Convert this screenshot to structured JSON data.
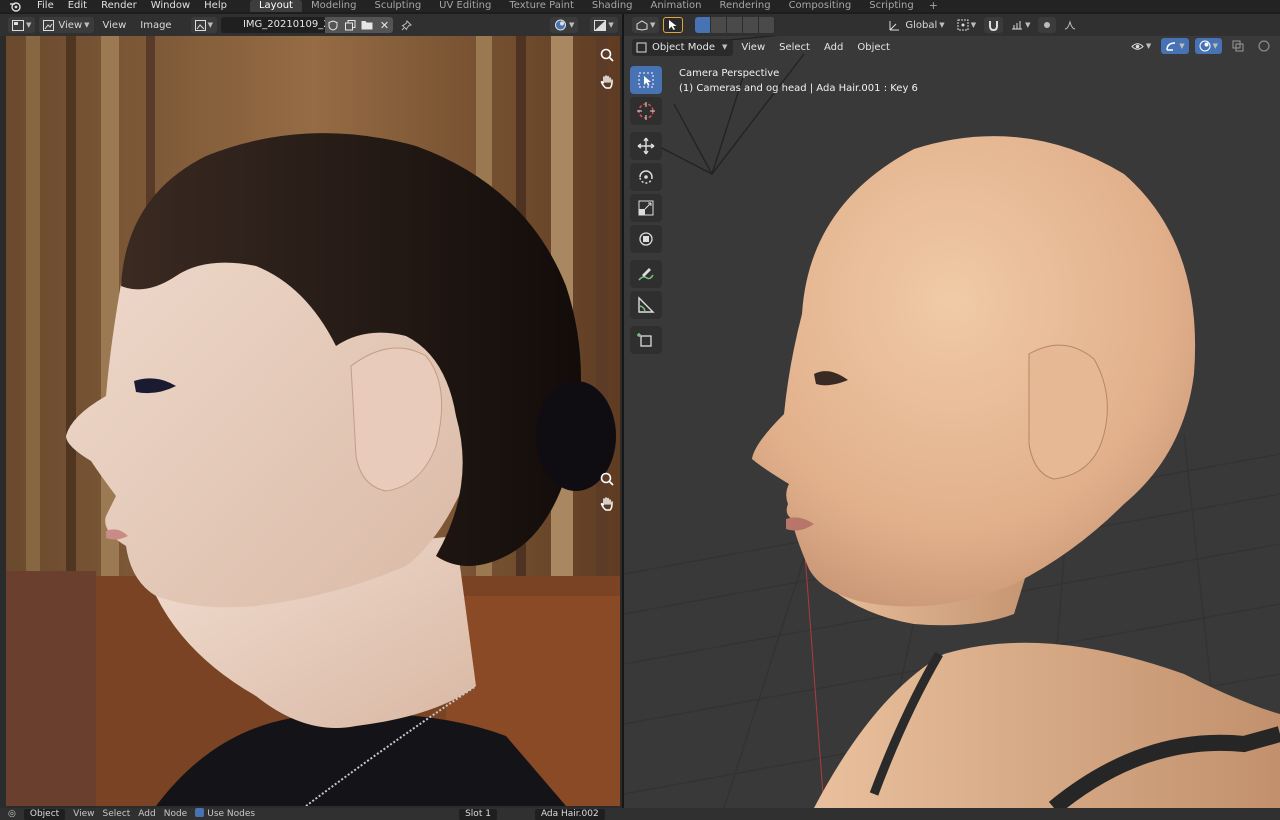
{
  "topbar": {
    "menus": [
      "File",
      "Edit",
      "Render",
      "Window",
      "Help"
    ],
    "workspaces": [
      "Layout",
      "Modeling",
      "Sculpting",
      "UV Editing",
      "Texture Paint",
      "Shading",
      "Animation",
      "Rendering",
      "Compositing",
      "Scripting"
    ],
    "active_workspace": "Layout",
    "add_label": "+"
  },
  "image_editor": {
    "view_dd": "View",
    "menu_view": "View",
    "menu_image": "Image",
    "image_name": "IMG_20210109_20..."
  },
  "viewport": {
    "mode": "Object Mode",
    "menus": [
      "View",
      "Select",
      "Add",
      "Object"
    ],
    "orientation": "Global",
    "camera_title": "Camera Perspective",
    "camera_subtitle": "(1) Cameras and og head | Ada Hair.001 : Key 6"
  },
  "bottombar": {
    "mode": "Object",
    "menus": [
      "View",
      "Select",
      "Add",
      "Node"
    ],
    "use_nodes": "Use Nodes",
    "slot": "Slot 1",
    "material": "Ada Hair.002"
  },
  "colors": {
    "accent": "#4772b3",
    "header": "#303030",
    "viewport_bg": "#393939"
  }
}
